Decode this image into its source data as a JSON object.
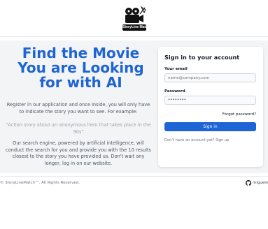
{
  "logo": {
    "brand_text": "StoryLine Match"
  },
  "hero": {
    "title": "Find the Movie You are Looking for with AI",
    "intro": "Register in our application and once inside, you will only have to indicate the story you want to see. For example:",
    "example": "\"Action story about an anonymous hero that takes place in the 90s\"",
    "engine": "Our search engine, powered by artificial intelligence, will conduct the search for you and provide you with the 10 results closest to the story you have provided us. Don't wait any longer, log in on our website."
  },
  "signin": {
    "title": "Sign in to your account",
    "email_label": "Your email",
    "email_placeholder": "name@company.com",
    "password_label": "Password",
    "password_value": "••••••••",
    "forgot": "Forgot password?",
    "button": "Sign in",
    "no_account": "Don't have an account yet?",
    "signup": "Sign up"
  },
  "footer": {
    "copyright": "© StoryLineMatch™. All Rights Reserved.",
    "github_user": "miguelro"
  },
  "colors": {
    "accent": "#1d64d4",
    "background": "#f3f4f6"
  },
  "icons": {
    "logo": "film-projector-icon",
    "github": "github-icon"
  }
}
